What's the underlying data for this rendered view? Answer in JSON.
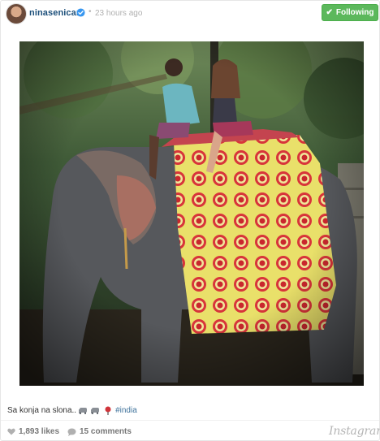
{
  "header": {
    "username": "ninasenicar",
    "separator": "•",
    "timestamp": "23 hours ago",
    "follow_label": "Following",
    "follow_color": "#5cb85c"
  },
  "photo": {
    "description_icon": "photo"
  },
  "caption": {
    "text": "Sa konja na slona..",
    "hashtag": "#india",
    "emojis": [
      "elephant-emoji",
      "elephant-emoji",
      "pin-emoji"
    ]
  },
  "footer": {
    "likes": "1,893 likes",
    "comments": "15 comments",
    "brand": "Instagram"
  },
  "colors": {
    "username": "#1c4f7a",
    "hashtag": "#3f729b",
    "muted": "#b0b0b0"
  }
}
